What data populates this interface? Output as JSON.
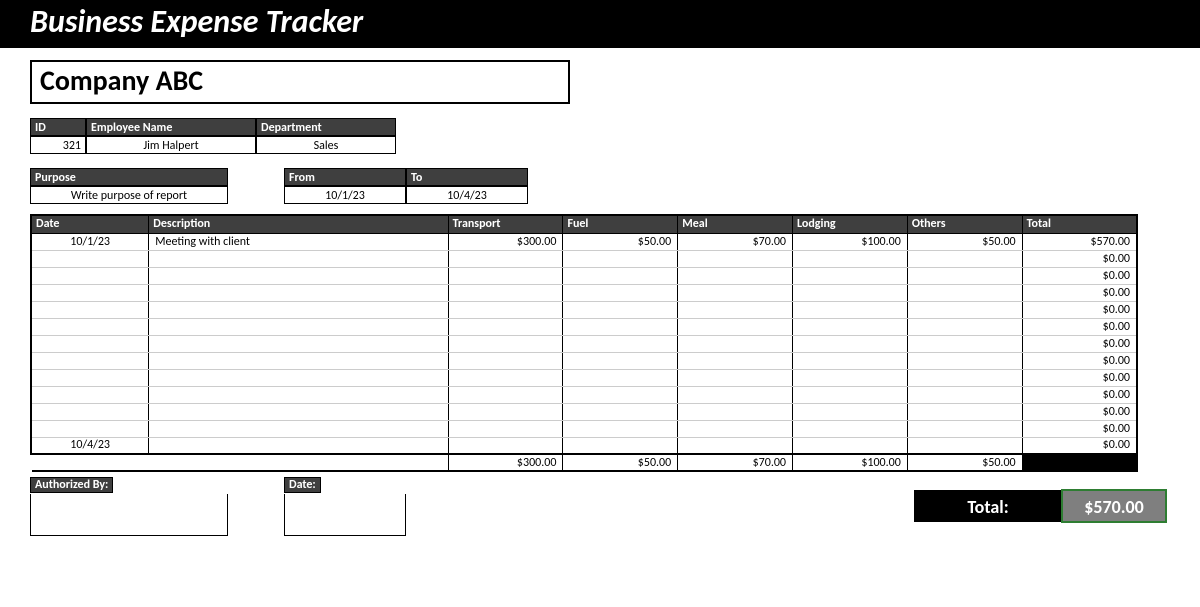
{
  "title": "Business Expense Tracker",
  "company": "Company ABC",
  "emp_headers": {
    "id": "ID",
    "name": "Employee Name",
    "dept": "Department"
  },
  "emp": {
    "id": "321",
    "name": "Jim Halpert",
    "dept": "Sales"
  },
  "purpose_header": "Purpose",
  "purpose": "Write purpose of report",
  "from_header": "From",
  "from": "10/1/23",
  "to_header": "To",
  "to": "10/4/23",
  "cols": {
    "date": "Date",
    "desc": "Description",
    "transport": "Transport",
    "fuel": "Fuel",
    "meal": "Meal",
    "lodging": "Lodging",
    "others": "Others",
    "total": "Total"
  },
  "rows": [
    {
      "date": "10/1/23",
      "desc": "Meeting with client",
      "transport": "$300.00",
      "fuel": "$50.00",
      "meal": "$70.00",
      "lodging": "$100.00",
      "others": "$50.00",
      "total": "$570.00"
    },
    {
      "date": "",
      "desc": "",
      "transport": "",
      "fuel": "",
      "meal": "",
      "lodging": "",
      "others": "",
      "total": "$0.00"
    },
    {
      "date": "",
      "desc": "",
      "transport": "",
      "fuel": "",
      "meal": "",
      "lodging": "",
      "others": "",
      "total": "$0.00"
    },
    {
      "date": "",
      "desc": "",
      "transport": "",
      "fuel": "",
      "meal": "",
      "lodging": "",
      "others": "",
      "total": "$0.00"
    },
    {
      "date": "",
      "desc": "",
      "transport": "",
      "fuel": "",
      "meal": "",
      "lodging": "",
      "others": "",
      "total": "$0.00"
    },
    {
      "date": "",
      "desc": "",
      "transport": "",
      "fuel": "",
      "meal": "",
      "lodging": "",
      "others": "",
      "total": "$0.00"
    },
    {
      "date": "",
      "desc": "",
      "transport": "",
      "fuel": "",
      "meal": "",
      "lodging": "",
      "others": "",
      "total": "$0.00"
    },
    {
      "date": "",
      "desc": "",
      "transport": "",
      "fuel": "",
      "meal": "",
      "lodging": "",
      "others": "",
      "total": "$0.00"
    },
    {
      "date": "",
      "desc": "",
      "transport": "",
      "fuel": "",
      "meal": "",
      "lodging": "",
      "others": "",
      "total": "$0.00"
    },
    {
      "date": "",
      "desc": "",
      "transport": "",
      "fuel": "",
      "meal": "",
      "lodging": "",
      "others": "",
      "total": "$0.00"
    },
    {
      "date": "",
      "desc": "",
      "transport": "",
      "fuel": "",
      "meal": "",
      "lodging": "",
      "others": "",
      "total": "$0.00"
    },
    {
      "date": "",
      "desc": "",
      "transport": "",
      "fuel": "",
      "meal": "",
      "lodging": "",
      "others": "",
      "total": "$0.00"
    },
    {
      "date": "10/4/23",
      "desc": "",
      "transport": "",
      "fuel": "",
      "meal": "",
      "lodging": "",
      "others": "",
      "total": "$0.00"
    }
  ],
  "subtotals": {
    "transport": "$300.00",
    "fuel": "$50.00",
    "meal": "$70.00",
    "lodging": "$100.00",
    "others": "$50.00"
  },
  "auth_header": "Authorized By:",
  "auth_date_header": "Date:",
  "grand_label": "Total:",
  "grand_value": "$570.00"
}
